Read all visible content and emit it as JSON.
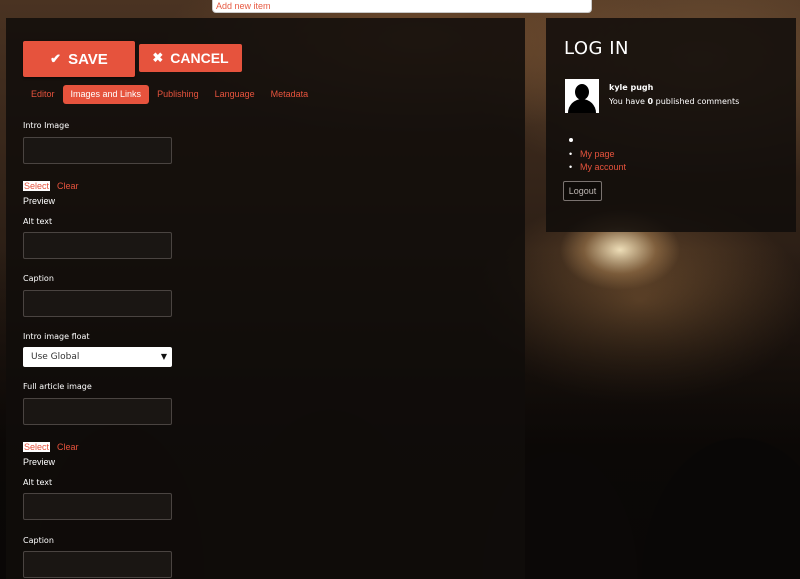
{
  "topbar": {
    "placeholder": "Add new item"
  },
  "toolbar": {
    "save_label": "SAVE",
    "cancel_label": "CANCEL",
    "save_icon": "check-icon",
    "cancel_icon": "close-icon"
  },
  "tabs": [
    {
      "label": "Editor",
      "active": false
    },
    {
      "label": "Images and Links",
      "active": true
    },
    {
      "label": "Publishing",
      "active": false
    },
    {
      "label": "Language",
      "active": false
    },
    {
      "label": "Metadata",
      "active": false
    }
  ],
  "form": {
    "intro_image_label": "Intro Image",
    "select_label": "Select",
    "clear_label": "Clear",
    "preview_label": "Preview",
    "alt_text_label": "Alt text",
    "caption_label": "Caption",
    "intro_float_label": "Intro image float",
    "intro_float_value": "Use Global",
    "full_image_label": "Full article image"
  },
  "login": {
    "title": "LOG IN",
    "user_name": "kyle pugh",
    "comments_prefix": "You have ",
    "comments_count": "0",
    "comments_suffix": " published comments",
    "menu": [
      "My page",
      "My account"
    ],
    "logout_label": "Logout"
  },
  "colors": {
    "accent": "#e6533d",
    "panel": "#100d0b"
  }
}
